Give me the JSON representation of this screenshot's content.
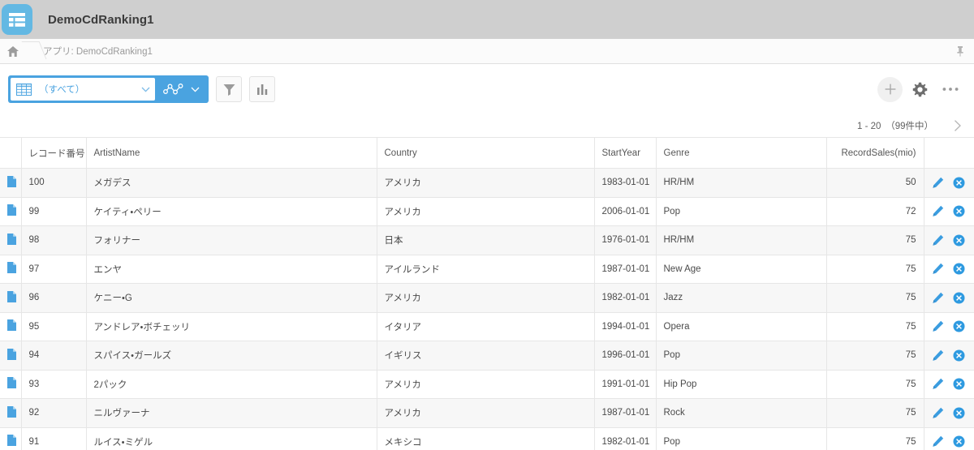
{
  "header": {
    "app_title": "DemoCdRanking1",
    "app_icon": "table-app-icon"
  },
  "breadcrumb": {
    "home_icon": "home-icon",
    "text": "アプリ: DemoCdRanking1",
    "pin_icon": "pin-icon"
  },
  "toolbar": {
    "view_selector": {
      "icon": "table-view-icon",
      "value": "（すべて）",
      "chevron_icon": "chevron-down-icon"
    },
    "graph_button": {
      "icon": "graph-nodes-icon",
      "chevron_icon": "chevron-down-icon"
    },
    "filter_button_icon": "filter-funnel-icon",
    "chart_button_icon": "bar-chart-icon",
    "add_button_icon": "plus-icon",
    "settings_button_icon": "gear-icon",
    "more_button_icon": "ellipsis-icon"
  },
  "pagination": {
    "range_text": "1 - 20　（99件中）",
    "next_icon": "chevron-right-icon"
  },
  "table": {
    "columns": [
      {
        "key": "doc",
        "label": ""
      },
      {
        "key": "rec",
        "label": "レコード番号"
      },
      {
        "key": "artist",
        "label": "ArtistName"
      },
      {
        "key": "country",
        "label": "Country"
      },
      {
        "key": "year",
        "label": "StartYear"
      },
      {
        "key": "genre",
        "label": "Genre"
      },
      {
        "key": "sales",
        "label": "RecordSales(mio)"
      },
      {
        "key": "act",
        "label": ""
      }
    ],
    "row_icons": {
      "document": "document-icon",
      "edit": "pencil-edit-icon",
      "delete": "delete-circle-icon"
    },
    "rows": [
      {
        "rec": "100",
        "artist": "メガデス",
        "country": "アメリカ",
        "year": "1983-01-01",
        "genre": "HR/HM",
        "sales": "50"
      },
      {
        "rec": "99",
        "artist": "ケイティ・ペリー",
        "country": "アメリカ",
        "year": "2006-01-01",
        "genre": "Pop",
        "sales": "72"
      },
      {
        "rec": "98",
        "artist": "フォリナー",
        "country": "日本",
        "year": "1976-01-01",
        "genre": "HR/HM",
        "sales": "75"
      },
      {
        "rec": "97",
        "artist": "エンヤ",
        "country": "アイルランド",
        "year": "1987-01-01",
        "genre": "New Age",
        "sales": "75"
      },
      {
        "rec": "96",
        "artist": "ケニー・G",
        "country": "アメリカ",
        "year": "1982-01-01",
        "genre": "Jazz",
        "sales": "75"
      },
      {
        "rec": "95",
        "artist": "アンドレア・ボチェッリ",
        "country": "イタリア",
        "year": "1994-01-01",
        "genre": "Opera",
        "sales": "75"
      },
      {
        "rec": "94",
        "artist": "スパイス・ガールズ",
        "country": "イギリス",
        "year": "1996-01-01",
        "genre": "Pop",
        "sales": "75"
      },
      {
        "rec": "93",
        "artist": "2パック",
        "country": "アメリカ",
        "year": "1991-01-01",
        "genre": "Hip Pop",
        "sales": "75"
      },
      {
        "rec": "92",
        "artist": "ニルヴァーナ",
        "country": "アメリカ",
        "year": "1987-01-01",
        "genre": "Rock",
        "sales": "75"
      },
      {
        "rec": "91",
        "artist": "ルイス・ミゲル",
        "country": "メキシコ",
        "year": "1982-01-01",
        "genre": "Pop",
        "sales": "75"
      }
    ]
  },
  "colors": {
    "accent_blue": "#4aa3e0",
    "app_icon_blue": "#63b8e3",
    "header_gray": "#cfcfcf",
    "row_alt": "#f7f7f7",
    "border": "#e6e6e6"
  }
}
